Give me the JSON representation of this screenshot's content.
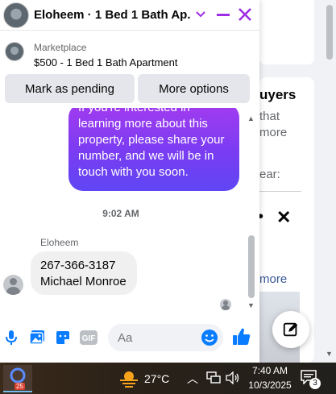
{
  "chat": {
    "title": "Eloheem · 1 Bed 1 Bath Ap...",
    "listing": {
      "label": "Marketplace",
      "title": "$500 - 1 Bed 1 Bath Apartment"
    },
    "buttons": {
      "mark_pending": "Mark as pending",
      "more_options": "More options"
    },
    "messages": {
      "outgoing_text": "If you're interested in learning more about this property, please share your number, and we will be in touch with you soon.",
      "timestamp": "9:02 AM",
      "sender_name": "Eloheem",
      "incoming_line1": "267-366-3187",
      "incoming_line2": "Michael Monroe"
    },
    "composer": {
      "placeholder": "Aa",
      "gif_label": "GIF"
    },
    "colors": {
      "accent": "#7a3cf2",
      "icon_blue": "#0a7cff",
      "close_purple": "#9d2ee6"
    }
  },
  "background": {
    "heading_fragment": "uyers",
    "line1": "that",
    "line2": "more",
    "line3": "ear:",
    "more_link": "more"
  },
  "taskbar": {
    "app_badge": "25",
    "temperature": "27°C",
    "time": "7:40 AM",
    "date": "10/3/2025",
    "notifications": "3"
  }
}
